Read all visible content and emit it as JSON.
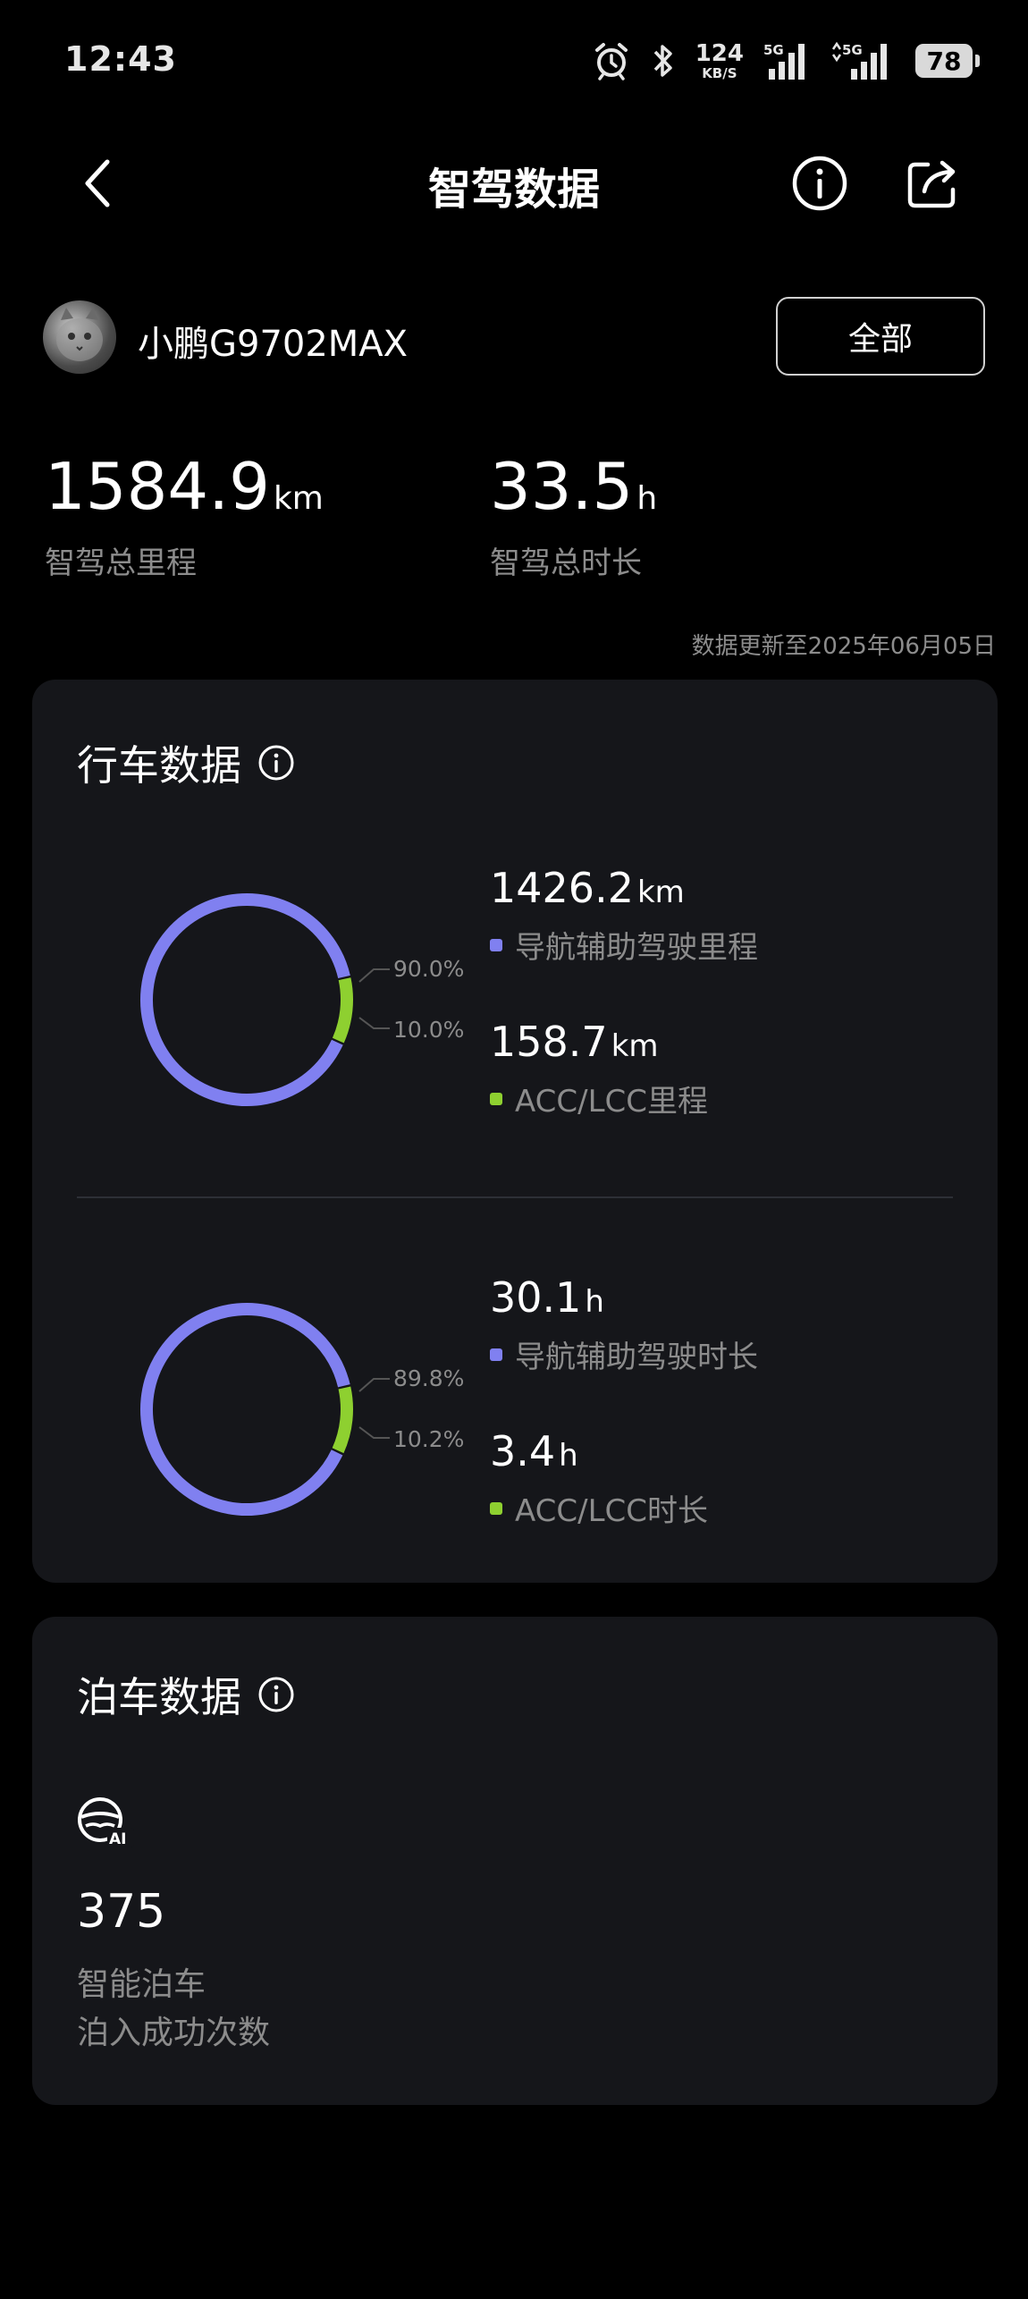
{
  "status_bar": {
    "time": "12:43",
    "net_speed": "124",
    "net_speed_unit": "KB/S",
    "signal1": "5G",
    "signal2": "5G",
    "battery": "78"
  },
  "header": {
    "title": "智驾数据"
  },
  "vehicle": {
    "name": "小鹏G9702MAX",
    "filter_label": "全部"
  },
  "summary": {
    "total_distance": "1584.9",
    "total_distance_unit": "km",
    "total_distance_label": "智驾总里程",
    "total_duration": "33.5",
    "total_duration_unit": "h",
    "total_duration_label": "智驾总时长",
    "update_note": "数据更新至2025年06月05日"
  },
  "colors": {
    "primary": "#8080f0",
    "secondary": "#8ed030",
    "card_bg": "#15161a"
  },
  "driving": {
    "title": "行车数据",
    "distance": {
      "ngp_value": "1426.2",
      "ngp_unit": "km",
      "ngp_label": "导航辅助驾驶里程",
      "acc_value": "158.7",
      "acc_unit": "km",
      "acc_label": "ACC/LCC里程",
      "ngp_pct_label": "90.0%",
      "acc_pct_label": "10.0%",
      "ngp_fraction": 0.9,
      "acc_fraction": 0.1
    },
    "duration": {
      "ngp_value": "30.1",
      "ngp_unit": "h",
      "ngp_label": "导航辅助驾驶时长",
      "acc_value": "3.4",
      "acc_unit": "h",
      "acc_label": "ACC/LCC时长",
      "ngp_pct_label": "89.8%",
      "acc_pct_label": "10.2%",
      "ngp_fraction": 0.898,
      "acc_fraction": 0.102
    }
  },
  "parking": {
    "title": "泊车数据",
    "count": "375",
    "label1": "智能泊车",
    "label2": "泊入成功次数"
  }
}
